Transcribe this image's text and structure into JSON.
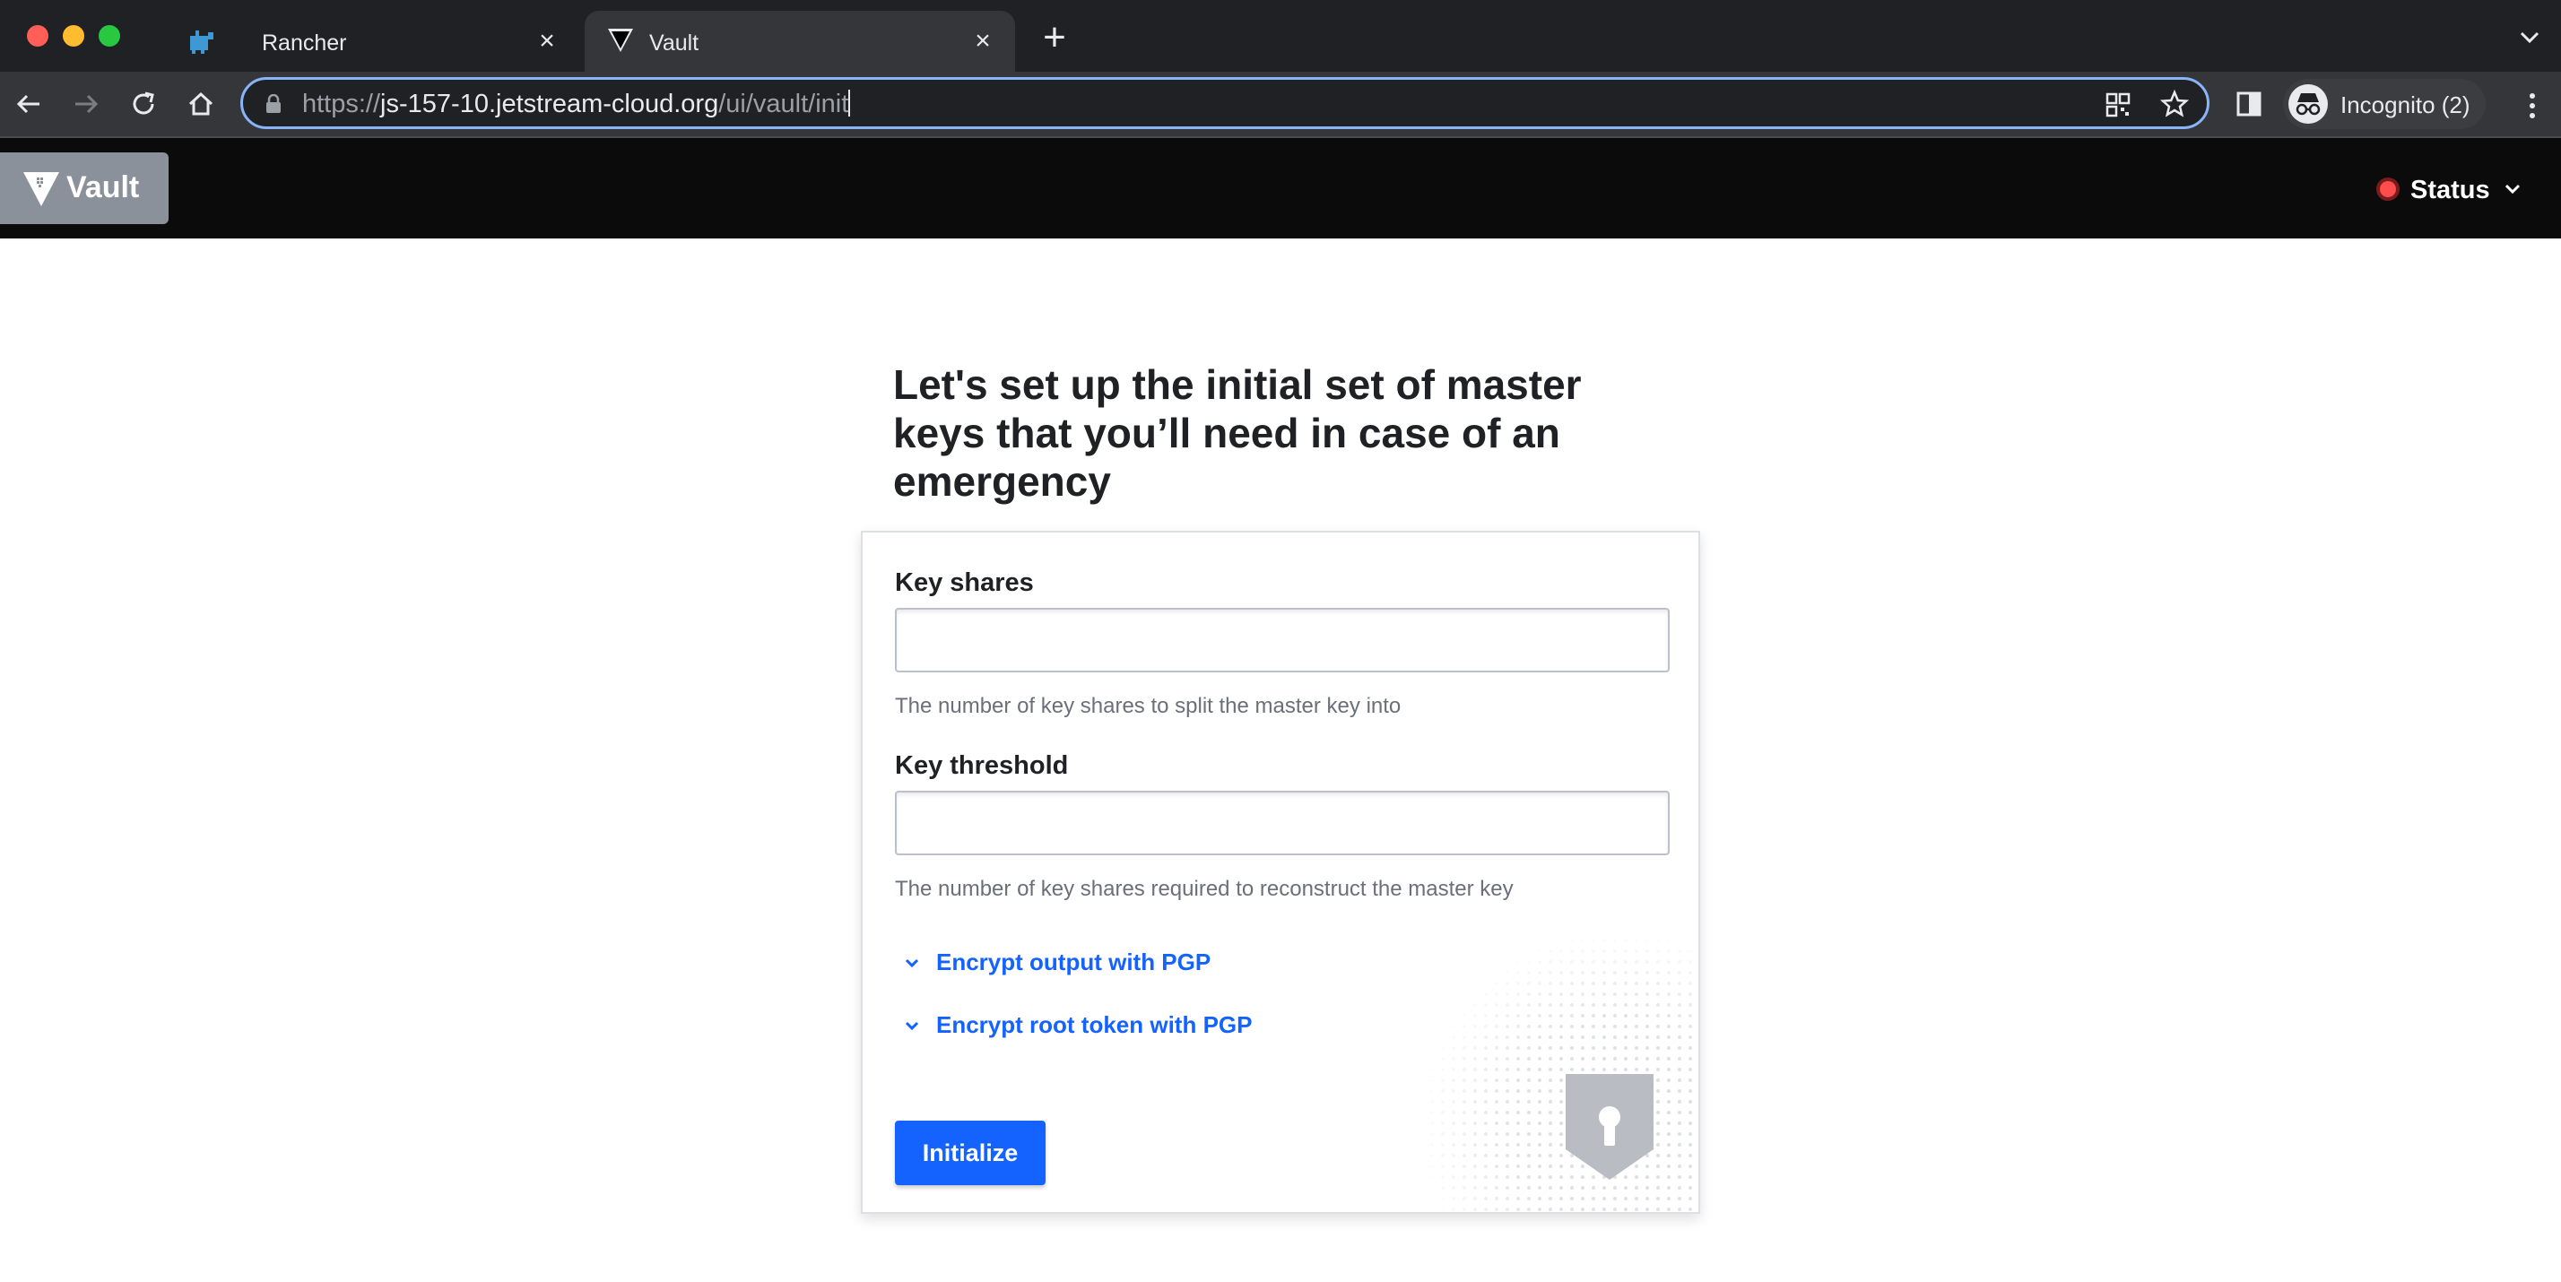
{
  "browser": {
    "tabs": [
      {
        "title": "Rancher",
        "active": false
      },
      {
        "title": "Vault",
        "active": true
      }
    ],
    "url": {
      "scheme": "https://",
      "host": "js-157-10.jetstream-cloud.org",
      "path": "/ui/vault/init"
    },
    "profile_label": "Incognito (2)"
  },
  "header": {
    "logo_text": "Vault",
    "status_label": "Status",
    "status_color": "#ff4d4d"
  },
  "main": {
    "title": "Let's set up the initial set of master keys that you’ll need in case of an emergency",
    "key_shares": {
      "label": "Key shares",
      "value": "",
      "help": "The number of key shares to split the master key into"
    },
    "key_threshold": {
      "label": "Key threshold",
      "value": "",
      "help": "The number of key shares required to reconstruct the master key"
    },
    "toggles": [
      {
        "label": "Encrypt output with PGP"
      },
      {
        "label": "Encrypt root token with PGP"
      }
    ],
    "submit_label": "Initialize"
  },
  "colors": {
    "accent": "#1563ff",
    "header_bg": "#0b0b0c",
    "logo_bg": "#8b919a"
  }
}
